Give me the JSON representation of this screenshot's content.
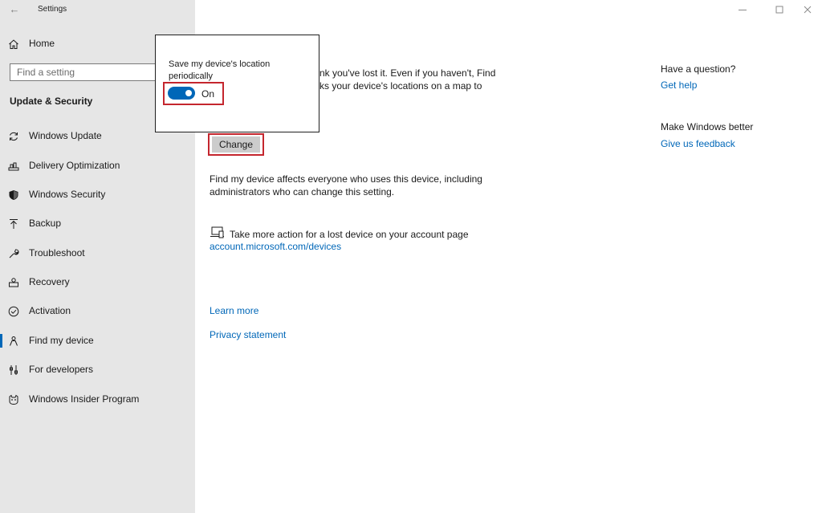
{
  "window": {
    "title": "Settings",
    "back_icon": "arrow-left-icon",
    "minimize_icon": "minimize-icon",
    "maximize_icon": "maximize-icon",
    "close_icon": "close-icon"
  },
  "sidebar": {
    "home_label": "Home",
    "search_placeholder": "Find a setting",
    "section_title": "Update & Security",
    "items": [
      {
        "label": "Windows Update",
        "icon": "refresh-icon"
      },
      {
        "label": "Delivery Optimization",
        "icon": "delivery-icon"
      },
      {
        "label": "Windows Security",
        "icon": "shield-icon"
      },
      {
        "label": "Backup",
        "icon": "upload-arrow-icon"
      },
      {
        "label": "Troubleshoot",
        "icon": "wrench-icon"
      },
      {
        "label": "Recovery",
        "icon": "recovery-icon"
      },
      {
        "label": "Activation",
        "icon": "check-circle-icon"
      },
      {
        "label": "Find my device",
        "icon": "person-location-icon",
        "selected": true
      },
      {
        "label": "For developers",
        "icon": "developer-icon"
      },
      {
        "label": "Windows Insider Program",
        "icon": "insider-cat-icon"
      }
    ]
  },
  "main": {
    "description_fragment_line1": "nk you've lost it. Even if you haven't, Find",
    "description_fragment_line2": "ks your device's locations on a map to",
    "change_button": "Change",
    "affects_line1": "Find my device affects everyone who uses this device, including",
    "affects_line2": "administrators who can change this setting.",
    "lost_device_text": "Take more action for a lost device on your account page",
    "account_link": "account.microsoft.com/devices",
    "learn_more": "Learn more",
    "privacy_statement": "Privacy statement"
  },
  "popup": {
    "text": "Save my device's location periodically",
    "toggle_state": "On",
    "toggle_on": true
  },
  "right_panel": {
    "question_heading": "Have a question?",
    "get_help": "Get help",
    "better_heading": "Make Windows better",
    "feedback_link": "Give us feedback"
  },
  "colors": {
    "accent": "#0067b8",
    "highlight_outline": "#c4262e",
    "sidebar_bg": "#e6e6e6"
  }
}
